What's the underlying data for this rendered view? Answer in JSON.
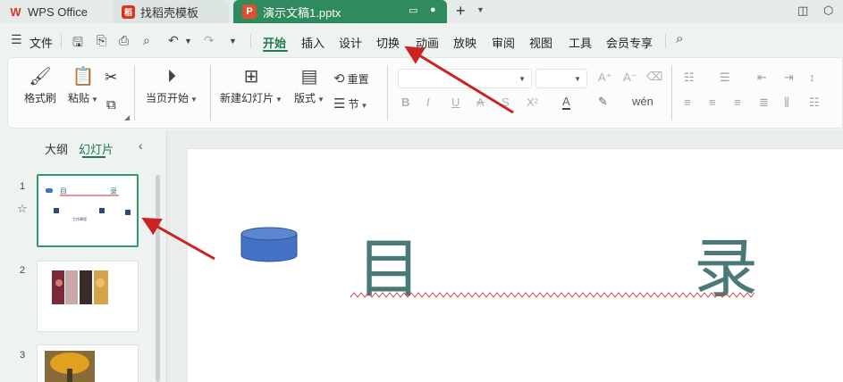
{
  "titlebar": {
    "tabs": [
      {
        "label": "WPS Office"
      },
      {
        "label": "找稻壳模板"
      },
      {
        "label": "演示文稿1.pptx"
      }
    ],
    "wps_logo": "W",
    "ppt_logo": "P",
    "template_logo": "稻"
  },
  "menubar": {
    "file": "文件",
    "items": [
      "开始",
      "插入",
      "设计",
      "切换",
      "动画",
      "放映",
      "审阅",
      "视图",
      "工具",
      "会员专享"
    ]
  },
  "ribbon": {
    "format_painter": "格式刷",
    "paste": "粘贴",
    "play_from_current": "当页开始",
    "new_slide": "新建幻灯片",
    "layout": "版式",
    "reset": "重置",
    "section": "节"
  },
  "left_panel": {
    "tab_outline": "大纲",
    "tab_slides": "幻灯片",
    "slide_numbers": [
      "1",
      "2",
      "3"
    ],
    "thumb1_caption": "工作章程"
  },
  "slide": {
    "char_left": "目",
    "char_right": "录"
  },
  "colors": {
    "accent": "#1f7a4c",
    "active_tab": "#2f8a5d",
    "arrow": "#cc2222",
    "shape_fill": "#4472c4"
  }
}
